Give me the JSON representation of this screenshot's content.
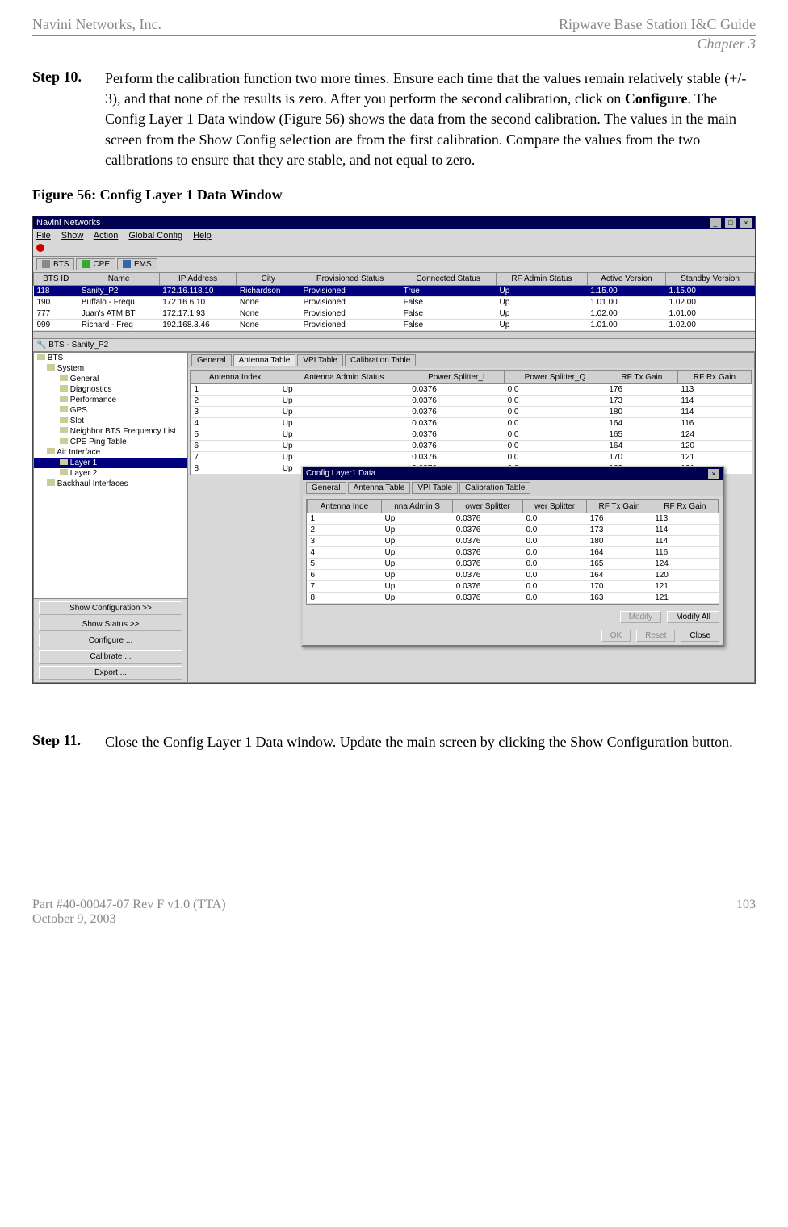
{
  "header": {
    "left": "Navini Networks, Inc.",
    "right": "Ripwave Base Station I&C Guide",
    "chapter": "Chapter 3"
  },
  "step10": {
    "label": "Step 10.",
    "text_pre": "Perform the calibration function two more times. Ensure each time that the values remain relatively stable (+/- 3), and that none of the results is zero. After you perform the second calibration, click on ",
    "bold": "Configure",
    "text_post": ". The Config Layer 1 Data window (Figure 56) shows the data from the second calibration. The values in the main screen from the Show Config selection are from the first calibration. Compare the values from the two calibrations to ensure that they are stable, and not equal to zero."
  },
  "figcap": "Figure 56:  Config Layer 1 Data Window",
  "app": {
    "title": "Navini Networks",
    "menus": [
      "File",
      "Show",
      "Action",
      "Global Config",
      "Help"
    ],
    "tabs": [
      "BTS",
      "CPE",
      "EMS"
    ],
    "bts_cols": [
      "BTS ID",
      "Name",
      "IP Address",
      "City",
      "Provisioned Status",
      "Connected Status",
      "RF Admin Status",
      "Active Version",
      "Standby Version"
    ],
    "bts_rows": [
      [
        "118",
        "Sanity_P2",
        "172.16.118.10",
        "Richardson",
        "Provisioned",
        "True",
        "Up",
        "1.15.00",
        "1.15.00"
      ],
      [
        "190",
        "Buffalo - Frequ",
        "172.16.6.10",
        "None",
        "Provisioned",
        "False",
        "Up",
        "1.01.00",
        "1.02.00"
      ],
      [
        "777",
        "Juan's ATM BT",
        "172.17.1.93",
        "None",
        "Provisioned",
        "False",
        "Up",
        "1.02.00",
        "1.01.00"
      ],
      [
        "999",
        "Richard - Freq",
        "192.168.3.46",
        "None",
        "Provisioned",
        "False",
        "Up",
        "1.01.00",
        "1.02.00"
      ]
    ],
    "bts_panel_label": "BTS - Sanity_P2",
    "tree": [
      {
        "t": "BTS",
        "lvl": 0
      },
      {
        "t": "System",
        "lvl": 1
      },
      {
        "t": "General",
        "lvl": 2
      },
      {
        "t": "Diagnostics",
        "lvl": 2
      },
      {
        "t": "Performance",
        "lvl": 2
      },
      {
        "t": "GPS",
        "lvl": 2
      },
      {
        "t": "Slot",
        "lvl": 2
      },
      {
        "t": "Neighbor BTS Frequency List",
        "lvl": 2
      },
      {
        "t": "CPE Ping Table",
        "lvl": 2
      },
      {
        "t": "Air Interface",
        "lvl": 1
      },
      {
        "t": "Layer 1",
        "lvl": 2,
        "sel": true
      },
      {
        "t": "Layer 2",
        "lvl": 2
      },
      {
        "t": "Backhaul Interfaces",
        "lvl": 1
      }
    ],
    "side_buttons": [
      "Show Configuration >>",
      "Show Status >>",
      "Configure ...",
      "Calibrate ...",
      "Export ..."
    ],
    "inner_tabs": [
      "General",
      "Antenna Table",
      "VPI Table",
      "Calibration Table"
    ],
    "antenna_cols": [
      "Antenna Index",
      "Antenna Admin Status",
      "Power Splitter_I",
      "Power Splitter_Q",
      "RF Tx Gain",
      "RF Rx Gain"
    ],
    "antenna_rows": [
      [
        "1",
        "Up",
        "0.0376",
        "0.0",
        "176",
        "113"
      ],
      [
        "2",
        "Up",
        "0.0376",
        "0.0",
        "173",
        "114"
      ],
      [
        "3",
        "Up",
        "0.0376",
        "0.0",
        "180",
        "114"
      ],
      [
        "4",
        "Up",
        "0.0376",
        "0.0",
        "164",
        "116"
      ],
      [
        "5",
        "Up",
        "0.0376",
        "0.0",
        "165",
        "124"
      ],
      [
        "6",
        "Up",
        "0.0376",
        "0.0",
        "164",
        "120"
      ],
      [
        "7",
        "Up",
        "0.0376",
        "0.0",
        "170",
        "121"
      ],
      [
        "8",
        "Up",
        "0.0376",
        "0.0",
        "163",
        "121"
      ]
    ],
    "dialog": {
      "title": "Config Layer1 Data",
      "tabs": [
        "General",
        "Antenna Table",
        "VPI Table",
        "Calibration Table"
      ],
      "cols": [
        "Antenna Inde",
        "nna Admin S",
        "ower Splitter",
        "wer Splitter",
        "RF Tx Gain",
        "RF Rx Gain"
      ],
      "rows": [
        [
          "1",
          "Up",
          "0.0376",
          "0.0",
          "176",
          "113"
        ],
        [
          "2",
          "Up",
          "0.0376",
          "0.0",
          "173",
          "114"
        ],
        [
          "3",
          "Up",
          "0.0376",
          "0.0",
          "180",
          "114"
        ],
        [
          "4",
          "Up",
          "0.0376",
          "0.0",
          "164",
          "116"
        ],
        [
          "5",
          "Up",
          "0.0376",
          "0.0",
          "165",
          "124"
        ],
        [
          "6",
          "Up",
          "0.0376",
          "0.0",
          "164",
          "120"
        ],
        [
          "7",
          "Up",
          "0.0376",
          "0.0",
          "170",
          "121"
        ],
        [
          "8",
          "Up",
          "0.0376",
          "0.0",
          "163",
          "121"
        ]
      ],
      "btn_modify": "Modify",
      "btn_modify_all": "Modify All",
      "btn_ok": "OK",
      "btn_reset": "Reset",
      "btn_close": "Close"
    }
  },
  "step11": {
    "label": "Step 11.",
    "text": "Close the Config Layer 1 Data window. Update the main screen by clicking the Show Configuration button."
  },
  "footer": {
    "left": "Part #40-00047-07 Rev F v1.0 (TTA)",
    "right": "103",
    "date": "October 9, 2003"
  }
}
